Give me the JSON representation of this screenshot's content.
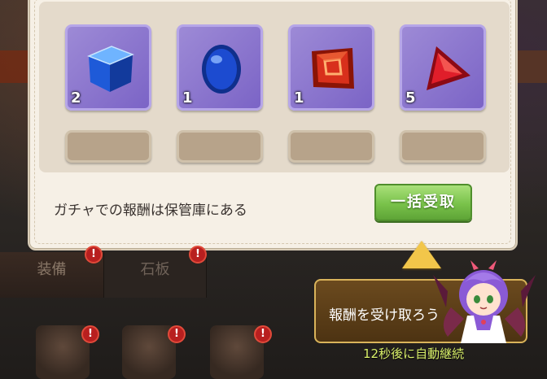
{
  "rewards": {
    "items": [
      {
        "name": "blue-cube-gem",
        "count": "2",
        "color": "#2e6de0"
      },
      {
        "name": "blue-egg-gem",
        "count": "1",
        "color": "#1c4bd0"
      },
      {
        "name": "red-square-gem",
        "count": "1",
        "color": "#d8301c"
      },
      {
        "name": "red-triangle-gem",
        "count": "5",
        "color": "#e01e2a"
      }
    ],
    "caption": "ガチャでの報酬は保管庫にある",
    "collect_all_label": "一括受取"
  },
  "tabs": [
    {
      "label": "装備"
    },
    {
      "label": "石板"
    }
  ],
  "badges": {
    "mark": "!"
  },
  "tutorial": {
    "message": "報酬を受け取ろう",
    "auto_continue": "12秒後に自動継続"
  },
  "colors": {
    "panel": "#f6f0e6",
    "item_bg": "#8a74cf",
    "button_green": "#79c24a",
    "tooltip_bg": "#5b3d16",
    "continue_text": "#d9f06a"
  }
}
